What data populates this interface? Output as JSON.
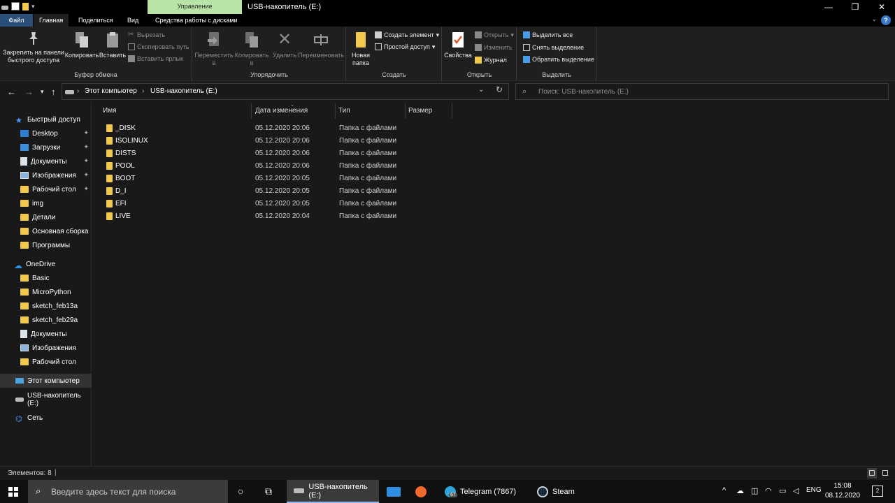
{
  "window": {
    "title": "USB-накопитель (E:)",
    "manage_tab": "Управление",
    "minimize": "—",
    "maximize": "❐",
    "close": "✕"
  },
  "tabs": {
    "file": "Файл",
    "home": "Главная",
    "share": "Поделиться",
    "view": "Вид",
    "drive_tools": "Средства работы с дисками",
    "help": "?"
  },
  "ribbon": {
    "clipboard": {
      "label": "Буфер обмена",
      "pin": "Закрепить на панели быстрого доступа",
      "copy": "Копировать",
      "paste": "Вставить",
      "cut": "Вырезать",
      "copy_path": "Скопировать путь",
      "paste_shortcut": "Вставить ярлык"
    },
    "organize": {
      "label": "Упорядочить",
      "move_to": "Переместить в",
      "copy_to": "Копировать в",
      "delete": "Удалить",
      "rename": "Переименовать"
    },
    "create": {
      "label": "Создать",
      "new_folder": "Новая папка",
      "new_item": "Создать элемент",
      "easy_access": "Простой доступ"
    },
    "open": {
      "label": "Открыть",
      "properties": "Свойства",
      "open": "Открыть",
      "edit": "Изменить",
      "history": "Журнал"
    },
    "select": {
      "label": "Выделить",
      "select_all": "Выделить все",
      "select_none": "Снять выделение",
      "invert": "Обратить выделение"
    }
  },
  "address": {
    "crumbs": [
      "Этот компьютер",
      "USB-накопитель (E:)"
    ],
    "search_placeholder": "Поиск: USB-накопитель (E:)"
  },
  "nav": {
    "quick_access": "Быстрый доступ",
    "quick_items": [
      {
        "label": "Desktop",
        "icon": "desktop-icon"
      },
      {
        "label": "Загрузки",
        "icon": "downloads-icon"
      },
      {
        "label": "Документы",
        "icon": "documents-icon"
      },
      {
        "label": "Изображения",
        "icon": "pictures-icon"
      },
      {
        "label": "Рабочий стол",
        "icon": "folder-icon"
      },
      {
        "label": "img",
        "icon": "folder-icon"
      },
      {
        "label": "Детали",
        "icon": "folder-icon"
      },
      {
        "label": "Основная сборка",
        "icon": "folder-icon"
      },
      {
        "label": "Программы",
        "icon": "folder-icon"
      }
    ],
    "onedrive": "OneDrive",
    "onedrive_items": [
      {
        "label": "Basic",
        "icon": "folder-icon"
      },
      {
        "label": "MicroPython",
        "icon": "folder-icon"
      },
      {
        "label": "sketch_feb13a",
        "icon": "folder-icon"
      },
      {
        "label": "sketch_feb29a",
        "icon": "folder-icon"
      },
      {
        "label": "Документы",
        "icon": "documents-icon"
      },
      {
        "label": "Изображения",
        "icon": "pictures-icon"
      },
      {
        "label": "Рабочий стол",
        "icon": "folder-icon"
      }
    ],
    "this_pc": "Этот компьютер",
    "usb": "USB-накопитель (E:)",
    "network": "Сеть"
  },
  "columns": {
    "name": "Имя",
    "date": "Дата изменения",
    "type": "Тип",
    "size": "Размер"
  },
  "files": [
    {
      "name": "_DISK",
      "date": "05.12.2020 20:06",
      "type": "Папка с файлами"
    },
    {
      "name": "ISOLINUX",
      "date": "05.12.2020 20:06",
      "type": "Папка с файлами"
    },
    {
      "name": "DISTS",
      "date": "05.12.2020 20:06",
      "type": "Папка с файлами"
    },
    {
      "name": "POOL",
      "date": "05.12.2020 20:06",
      "type": "Папка с файлами"
    },
    {
      "name": "BOOT",
      "date": "05.12.2020 20:05",
      "type": "Папка с файлами"
    },
    {
      "name": "D_I",
      "date": "05.12.2020 20:05",
      "type": "Папка с файлами"
    },
    {
      "name": "EFI",
      "date": "05.12.2020 20:05",
      "type": "Папка с файлами"
    },
    {
      "name": "LIVE",
      "date": "05.12.2020 20:04",
      "type": "Папка с файлами"
    }
  ],
  "status": {
    "items": "Элементов: 8"
  },
  "taskbar": {
    "search_placeholder": "Введите здесь текст для поиска",
    "apps": [
      {
        "label": "USB-накопитель (E:)"
      },
      {
        "label": "Telegram (7867)"
      },
      {
        "label": "Steam"
      }
    ],
    "lang": "ENG",
    "time": "15:08",
    "date": "08.12.2020",
    "notifications": "2",
    "telegram_badge": "67"
  },
  "colors": {
    "accent": "#2a4f78",
    "manage_tab": "#b9e4a7",
    "folder": "#f3c94d"
  }
}
